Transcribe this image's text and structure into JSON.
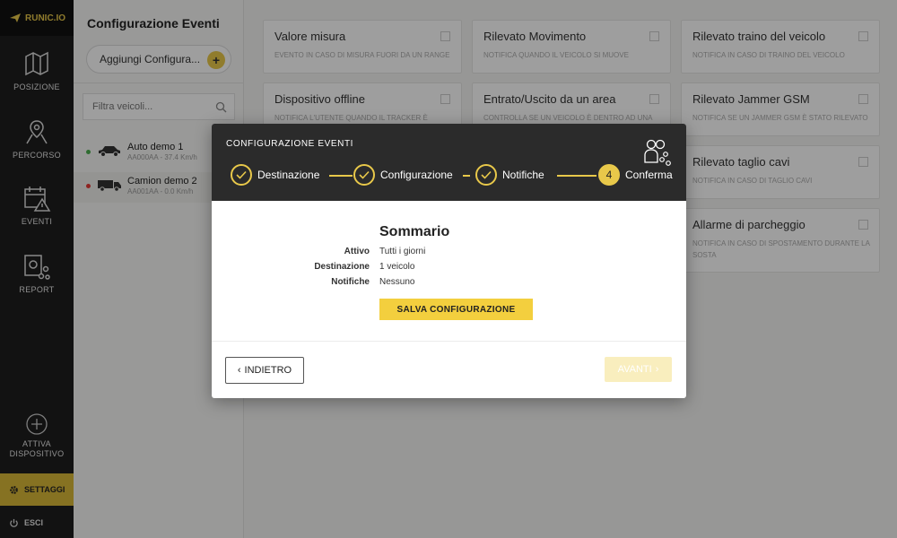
{
  "app": {
    "logo_text": "RUNIC.IO"
  },
  "nav": {
    "items": [
      {
        "label": "POSIZIONE",
        "icon": "map-icon"
      },
      {
        "label": "PERCORSO",
        "icon": "route-pin-icon"
      },
      {
        "label": "EVENTI",
        "icon": "calendar-alert-icon"
      },
      {
        "label": "REPORT",
        "icon": "report-share-icon"
      }
    ],
    "activate_line1": "ATTIVA",
    "activate_line2": "DISPOSITIVO",
    "settings": "SETTAGGI",
    "exit": "ESCI"
  },
  "panel": {
    "title": "Configurazione Eventi",
    "add_button": "Aggiungi Configura...",
    "filter_placeholder": "Filtra veicoli...",
    "vehicles": [
      {
        "name": "Auto demo 1",
        "sub": "AA000AA - 37.4 Km/h",
        "status_color": "#4caf50",
        "icon": "car-icon"
      },
      {
        "name": "Camion demo 2",
        "sub": "AA001AA - 0.0 Km/h",
        "status_color": "#e53935",
        "icon": "truck-icon"
      }
    ]
  },
  "events": [
    {
      "title": "Valore misura",
      "desc": "EVENTO IN CASO DI MISURA FUORI DA UN RANGE"
    },
    {
      "title": "Rilevato Movimento",
      "desc": "NOTIFICA QUANDO IL VEICOLO SI MUOVE"
    },
    {
      "title": "Rilevato traino del veicolo",
      "desc": "NOTIFICA IN CASO DI TRAINO DEL VEICOLO"
    },
    {
      "title": "Dispositivo offline",
      "desc": "NOTIFICA L'UTENTE QUANDO IL TRACKER È"
    },
    {
      "title": "Entrato/Uscito da un area",
      "desc": "CONTROLLA SE UN VEICOLO È DENTRO AD UNA"
    },
    {
      "title": "Rilevato Jammer GSM",
      "desc": "NOTIFICA SE UN JAMMER GSM È STATO RILEVATO"
    },
    {
      "title": "Rilevato taglio cavi",
      "desc": "NOTIFICA IN CASO DI TAGLIO CAVI"
    },
    {
      "title": "Allarme di parcheggio",
      "desc": "NOTIFICA IN CASO DI SPOSTAMENTO DURANTE LA SOSTA"
    }
  ],
  "modal": {
    "title": "CONFIGURAZIONE EVENTI",
    "steps": [
      {
        "label": "Destinazione",
        "state": "done"
      },
      {
        "label": "Configurazione",
        "state": "done"
      },
      {
        "label": "Notifiche",
        "state": "done"
      },
      {
        "label": "Conferma",
        "state": "active",
        "number": "4"
      }
    ],
    "summary_title": "Sommario",
    "rows": [
      {
        "key": "Attivo",
        "value": "Tutti i giorni"
      },
      {
        "key": "Destinazione",
        "value": "1 veicolo"
      },
      {
        "key": "Notifiche",
        "value": "Nessuno"
      }
    ],
    "save_button": "SALVA CONFIGURAZIONE",
    "back_button": "INDIETRO",
    "next_button": "AVANTI"
  },
  "colors": {
    "accent": "#e8c84a",
    "nav_bg": "#1d1d1d",
    "modal_header": "#2b2b2b"
  }
}
